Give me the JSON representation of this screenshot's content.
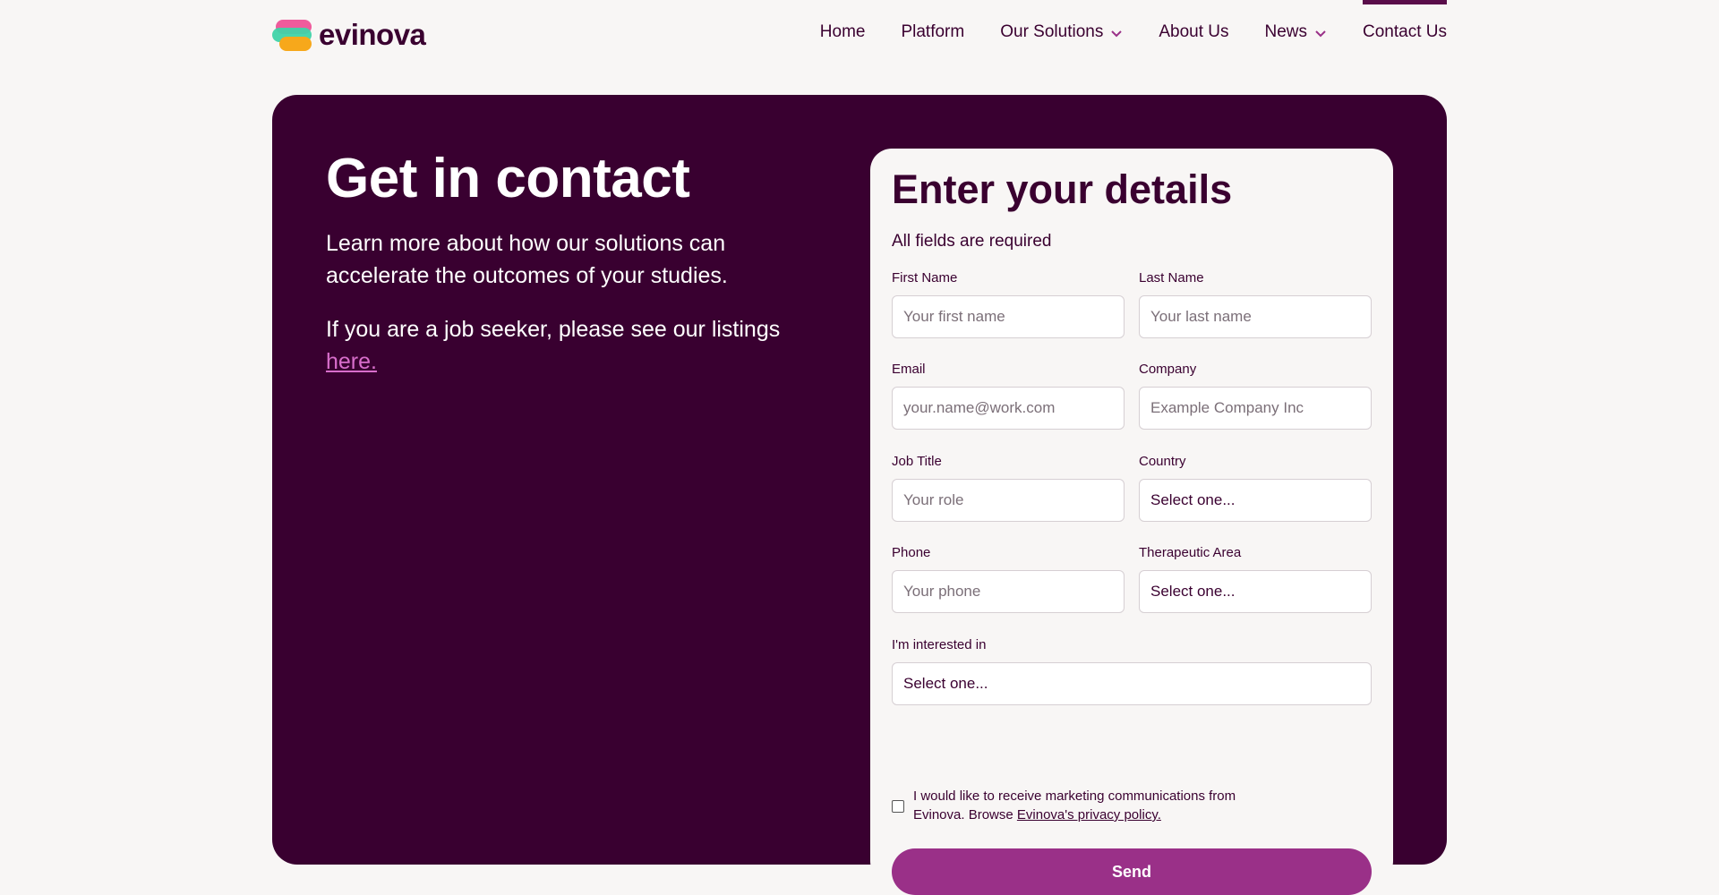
{
  "brand": {
    "name": "evinova"
  },
  "nav": {
    "items": [
      {
        "label": "Home",
        "dropdown": false,
        "active": false
      },
      {
        "label": "Platform",
        "dropdown": false,
        "active": false
      },
      {
        "label": "Our Solutions",
        "dropdown": true,
        "active": false
      },
      {
        "label": "About Us",
        "dropdown": false,
        "active": false
      },
      {
        "label": "News",
        "dropdown": true,
        "active": false
      },
      {
        "label": "Contact Us",
        "dropdown": false,
        "active": true
      }
    ]
  },
  "hero": {
    "title": "Get in contact",
    "paragraph1": "Learn more about how our solutions can accelerate the outcomes of your studies.",
    "paragraph2_prefix": "If you are a job seeker, please see our listings ",
    "paragraph2_link": "here."
  },
  "form": {
    "title": "Enter your details",
    "subtitle": "All fields are required",
    "first_name": {
      "label": "First Name",
      "placeholder": "Your first name"
    },
    "last_name": {
      "label": "Last Name",
      "placeholder": "Your last name"
    },
    "email": {
      "label": "Email",
      "placeholder": "your.name@work.com"
    },
    "company": {
      "label": "Company",
      "placeholder": "Example Company Inc"
    },
    "job_title": {
      "label": "Job Title",
      "placeholder": "Your role"
    },
    "country": {
      "label": "Country",
      "value": "Select one..."
    },
    "phone": {
      "label": "Phone",
      "placeholder": "Your phone"
    },
    "therapeutic_area": {
      "label": "Therapeutic Area",
      "value": "Select one..."
    },
    "interested_in": {
      "label": "I'm interested in",
      "value": "Select one..."
    },
    "consent": {
      "text": "I would like to receive marketing communications from Evinova. Browse ",
      "link": "Evinova's privacy policy.",
      "checked": false
    },
    "send_label": "Send"
  },
  "colors": {
    "primary_dark": "#390030",
    "accent": "#9a3088",
    "link_pink": "#d86ecb",
    "background": "#f8f6f5"
  }
}
